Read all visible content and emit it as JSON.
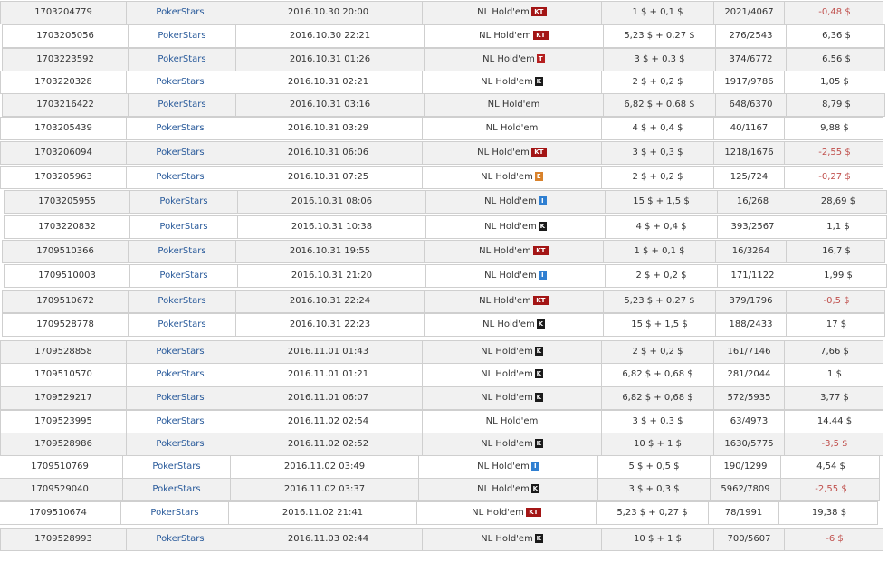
{
  "colors": {
    "room_link": "#2a5b9b",
    "negative": "#c0504d",
    "row_alt": "#f1f1f1",
    "border": "#cfcfcf"
  },
  "rows": [
    {
      "id": "1703204779",
      "room": "PokerStars",
      "date": "2016.10.30 20:00",
      "game": "NL Hold'em",
      "badge": "KT",
      "badge_type": "kt",
      "buyin": "1 $ + 0,1 $",
      "place": "2021/4067",
      "result": "-0,48 $",
      "neg": true
    },
    {
      "id": "1703205056",
      "room": "PokerStars",
      "date": "2016.10.30 22:21",
      "game": "NL Hold'em",
      "badge": "KT",
      "badge_type": "kt",
      "buyin": "5,23 $ + 0,27 $",
      "place": "276/2543",
      "result": "6,36 $",
      "neg": false
    },
    {
      "id": "1703223592",
      "room": "PokerStars",
      "date": "2016.10.31 01:26",
      "game": "NL Hold'em",
      "badge": "T",
      "badge_type": "t",
      "buyin": "3 $ + 0,3 $",
      "place": "374/6772",
      "result": "6,56 $",
      "neg": false
    },
    {
      "id": "1703220328",
      "room": "PokerStars",
      "date": "2016.10.31 02:21",
      "game": "NL Hold'em",
      "badge": "K",
      "badge_type": "k",
      "buyin": "2 $ + 0,2 $",
      "place": "1917/9786",
      "result": "1,05 $",
      "neg": false
    },
    {
      "id": "1703216422",
      "room": "PokerStars",
      "date": "2016.10.31 03:16",
      "game": "NL Hold'em",
      "badge": "",
      "badge_type": "",
      "buyin": "6,82 $ + 0,68 $",
      "place": "648/6370",
      "result": "8,79 $",
      "neg": false
    },
    {
      "id": "1703205439",
      "room": "PokerStars",
      "date": "2016.10.31 03:29",
      "game": "NL Hold'em",
      "badge": "",
      "badge_type": "",
      "buyin": "4 $ + 0,4 $",
      "place": "40/1167",
      "result": "9,88 $",
      "neg": false
    },
    {
      "id": "1703206094",
      "room": "PokerStars",
      "date": "2016.10.31 06:06",
      "game": "NL Hold'em",
      "badge": "KT",
      "badge_type": "kt",
      "buyin": "3 $ + 0,3 $",
      "place": "1218/1676",
      "result": "-2,55 $",
      "neg": true
    },
    {
      "id": "1703205963",
      "room": "PokerStars",
      "date": "2016.10.31 07:25",
      "game": "NL Hold'em",
      "badge": "E",
      "badge_type": "e",
      "buyin": "2 $ + 0,2 $",
      "place": "125/724",
      "result": "-0,27 $",
      "neg": true
    },
    {
      "id": "1703205955",
      "room": "PokerStars",
      "date": "2016.10.31 08:06",
      "game": "NL Hold'em",
      "badge": "I",
      "badge_type": "i",
      "buyin": "15 $ + 1,5 $",
      "place": "16/268",
      "result": "28,69 $",
      "neg": false
    },
    {
      "id": "1703220832",
      "room": "PokerStars",
      "date": "2016.10.31 10:38",
      "game": "NL Hold'em",
      "badge": "K",
      "badge_type": "k",
      "buyin": "4 $ + 0,4 $",
      "place": "393/2567",
      "result": "1,1 $",
      "neg": false
    },
    {
      "id": "1709510366",
      "room": "PokerStars",
      "date": "2016.10.31 19:55",
      "game": "NL Hold'em",
      "badge": "KT",
      "badge_type": "kt",
      "buyin": "1 $ + 0,1 $",
      "place": "16/3264",
      "result": "16,7 $",
      "neg": false
    },
    {
      "id": "1709510003",
      "room": "PokerStars",
      "date": "2016.10.31 21:20",
      "game": "NL Hold'em",
      "badge": "I",
      "badge_type": "i",
      "buyin": "2 $ + 0,2 $",
      "place": "171/1122",
      "result": "1,99 $",
      "neg": false
    },
    {
      "id": "1709510672",
      "room": "PokerStars",
      "date": "2016.10.31 22:24",
      "game": "NL Hold'em",
      "badge": "KT",
      "badge_type": "kt",
      "buyin": "5,23 $ + 0,27 $",
      "place": "379/1796",
      "result": "-0,5 $",
      "neg": true
    },
    {
      "id": "1709528778",
      "room": "PokerStars",
      "date": "2016.10.31 22:23",
      "game": "NL Hold'em",
      "badge": "K",
      "badge_type": "k",
      "buyin": "15 $ + 1,5 $",
      "place": "188/2433",
      "result": "17 $",
      "neg": false
    },
    {
      "id": "1709528858",
      "room": "PokerStars",
      "date": "2016.11.01 01:43",
      "game": "NL Hold'em",
      "badge": "K",
      "badge_type": "k",
      "buyin": "2 $ + 0,2 $",
      "place": "161/7146",
      "result": "7,66 $",
      "neg": false
    },
    {
      "id": "1709510570",
      "room": "PokerStars",
      "date": "2016.11.01 01:21",
      "game": "NL Hold'em",
      "badge": "K",
      "badge_type": "k",
      "buyin": "6,82 $ + 0,68 $",
      "place": "281/2044",
      "result": "1 $",
      "neg": false
    },
    {
      "id": "1709529217",
      "room": "PokerStars",
      "date": "2016.11.01 06:07",
      "game": "NL Hold'em",
      "badge": "K",
      "badge_type": "k",
      "buyin": "6,82 $ + 0,68 $",
      "place": "572/5935",
      "result": "3,77 $",
      "neg": false
    },
    {
      "id": "1709523995",
      "room": "PokerStars",
      "date": "2016.11.02 02:54",
      "game": "NL Hold'em",
      "badge": "",
      "badge_type": "",
      "buyin": "3 $ + 0,3 $",
      "place": "63/4973",
      "result": "14,44 $",
      "neg": false
    },
    {
      "id": "1709528986",
      "room": "PokerStars",
      "date": "2016.11.02 02:52",
      "game": "NL Hold'em",
      "badge": "K",
      "badge_type": "k",
      "buyin": "10 $ + 1 $",
      "place": "1630/5775",
      "result": "-3,5 $",
      "neg": true
    },
    {
      "id": "1709510769",
      "room": "PokerStars",
      "date": "2016.11.02 03:49",
      "game": "NL Hold'em",
      "badge": "I",
      "badge_type": "i",
      "buyin": "5 $ + 0,5 $",
      "place": "190/1299",
      "result": "4,54 $",
      "neg": false
    },
    {
      "id": "1709529040",
      "room": "PokerStars",
      "date": "2016.11.02 03:37",
      "game": "NL Hold'em",
      "badge": "K",
      "badge_type": "k",
      "buyin": "3 $ + 0,3 $",
      "place": "5962/7809",
      "result": "-2,55 $",
      "neg": true
    },
    {
      "id": "1709510674",
      "room": "PokerStars",
      "date": "2016.11.02 21:41",
      "game": "NL Hold'em",
      "badge": "KT",
      "badge_type": "kt",
      "buyin": "5,23 $ + 0,27 $",
      "place": "78/1991",
      "result": "19,38 $",
      "neg": false
    },
    {
      "id": "1709528993",
      "room": "PokerStars",
      "date": "2016.11.03 02:44",
      "game": "NL Hold'em",
      "badge": "K",
      "badge_type": "k",
      "buyin": "10 $ + 1 $",
      "place": "700/5607",
      "result": "-6 $",
      "neg": true
    }
  ]
}
